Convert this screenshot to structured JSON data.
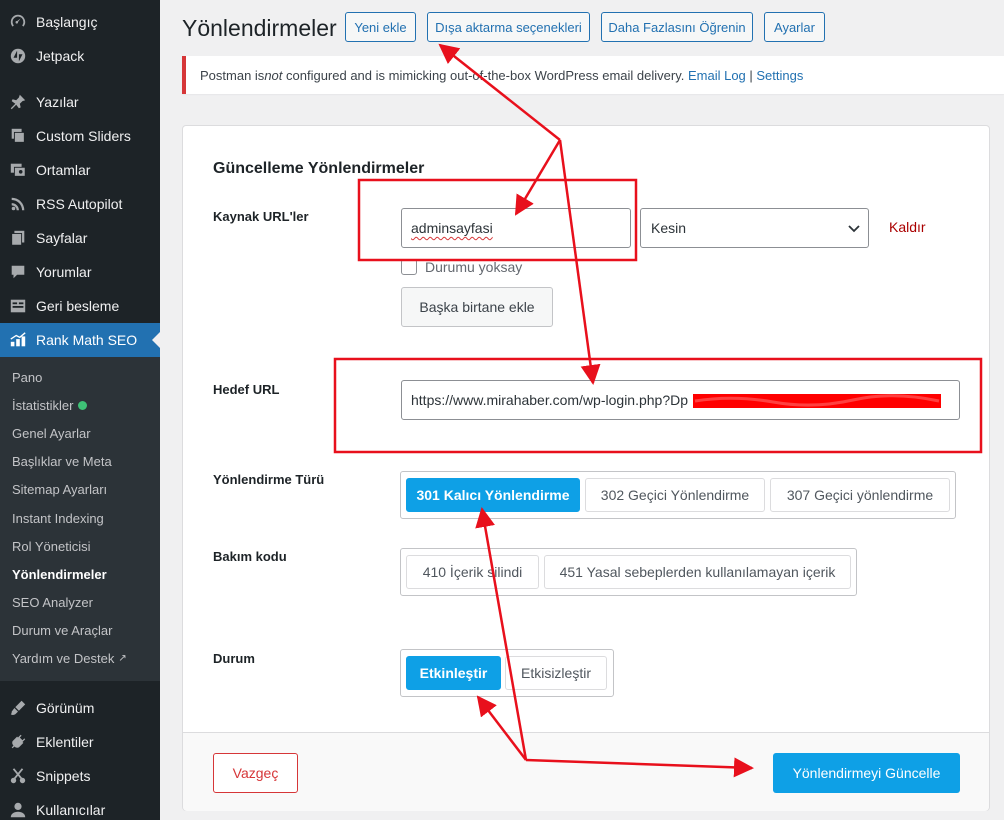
{
  "sidebar": {
    "top_items": [
      {
        "label": "Başlangıç",
        "icon": "dashboard-icon"
      },
      {
        "label": "Jetpack",
        "icon": "jetpack-icon"
      },
      {
        "label": "Yazılar",
        "icon": "pin-icon"
      },
      {
        "label": "Custom Sliders",
        "icon": "slides-icon"
      },
      {
        "label": "Ortamlar",
        "icon": "media-icon"
      },
      {
        "label": "RSS Autopilot",
        "icon": "rss-icon"
      },
      {
        "label": "Sayfalar",
        "icon": "pages-icon"
      },
      {
        "label": "Yorumlar",
        "icon": "comments-icon"
      },
      {
        "label": "Geri besleme",
        "icon": "feedback-icon"
      },
      {
        "label": "Rank Math SEO",
        "icon": "rank-math-icon"
      }
    ],
    "sub_items": [
      {
        "label": "Pano"
      },
      {
        "label": "İstatistikler"
      },
      {
        "label": "Genel Ayarlar"
      },
      {
        "label": "Başlıklar ve Meta"
      },
      {
        "label": "Sitemap Ayarları"
      },
      {
        "label": "Instant Indexing"
      },
      {
        "label": "Rol Yöneticisi"
      },
      {
        "label": "Yönlendirmeler"
      },
      {
        "label": "SEO Analyzer"
      },
      {
        "label": "Durum ve Araçlar"
      },
      {
        "label": "Yardım ve Destek"
      }
    ],
    "bottom_items": [
      {
        "label": "Görünüm",
        "icon": "appearance-icon"
      },
      {
        "label": "Eklentiler",
        "icon": "plugins-icon"
      },
      {
        "label": "Snippets",
        "icon": "snippets-icon"
      },
      {
        "label": "Kullanıcılar",
        "icon": "users-icon"
      }
    ]
  },
  "header": {
    "title": "Yönlendirmeler",
    "buttons": [
      "Yeni ekle",
      "Dışa aktarma seçenekleri",
      "Daha Fazlasını Öğrenin",
      "Ayarlar"
    ]
  },
  "notice": {
    "text_a": "Postman is ",
    "text_em": "not",
    "text_b": " configured and is mimicking out-of-the-box WordPress email delivery. ",
    "link1": "Email Log",
    "sep": " | ",
    "link2": "Settings"
  },
  "form": {
    "title": "Güncelleme Yönlendirmeler",
    "source_label": "Kaynak URL'ler",
    "source_value": "adminsayfasi",
    "match_value": "Kesin",
    "remove_label": "Kaldır",
    "ignore_case_label": "Durumu yoksay",
    "add_another_label": "Başka birtane ekle",
    "target_label": "Hedef URL",
    "target_value": "https://www.mirahaber.com/wp-login.php?Dp",
    "type_label": "Yönlendirme Türü",
    "type_options": [
      "301 Kalıcı Yönlendirme",
      "302 Geçici Yönlendirme",
      "307 Geçici yönlendirme"
    ],
    "maintenance_label": "Bakım kodu",
    "maintenance_options": [
      "410 İçerik silindi",
      "451 Yasal sebeplerden kullanılamayan içerik"
    ],
    "status_label": "Durum",
    "status_options": [
      "Etkinleştir",
      "Etkisizleştir"
    ],
    "cancel_label": "Vazgeç",
    "submit_label": "Yönlendirmeyi Güncelle"
  },
  "colors": {
    "accent": "#0ea0e6",
    "sidebar_bg": "#1d2327",
    "active_menu": "#2271b1",
    "annotation": "#e8101c"
  }
}
